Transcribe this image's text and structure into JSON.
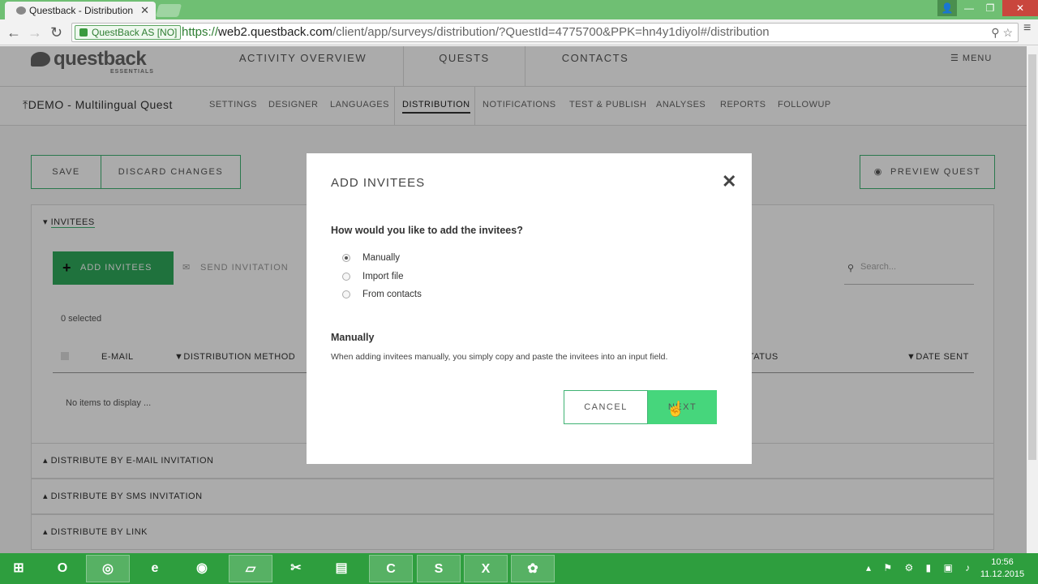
{
  "browser": {
    "tab_title": "Questback - Distribution",
    "secure_label": "QuestBack AS [NO]",
    "url_scheme": "https://",
    "url_domain": "web2.questback.com",
    "url_path": "/client/app/surveys/distribution/?QuestId=4775700&PPK=hn4y1diyol#/distribution"
  },
  "app": {
    "logo": "questback",
    "logo_sub": "ESSENTIALS",
    "top_nav": [
      "ACTIVITY OVERVIEW",
      "QUESTS",
      "CONTACTS"
    ],
    "menu_label": "MENU",
    "quest_title": "DEMO - Multilingual Quest",
    "sub_nav": [
      "SETTINGS",
      "DESIGNER",
      "LANGUAGES",
      "DISTRIBUTION",
      "NOTIFICATIONS",
      "TEST & PUBLISH",
      "ANALYSES",
      "REPORTS",
      "FOLLOWUP"
    ],
    "active_sub_nav": "DISTRIBUTION",
    "save_label": "SAVE",
    "discard_label": "DISCARD CHANGES",
    "preview_label": "PREVIEW QUEST",
    "invitees_header": "INVITEES",
    "add_invitees_label": "ADD INVITEES",
    "send_invitation_label": "SEND INVITATION",
    "search_placeholder": "Search...",
    "selected_text": "0 selected",
    "columns": [
      "E-MAIL",
      "DISTRIBUTION METHOD",
      "STATUS",
      "DATE SENT"
    ],
    "no_items": "No items to display ...",
    "accordions": [
      "DISTRIBUTE BY E-MAIL INVITATION",
      "DISTRIBUTE BY SMS INVITATION",
      "DISTRIBUTE BY LINK"
    ]
  },
  "modal": {
    "title": "ADD INVITEES",
    "question": "How would you like to add the invitees?",
    "options": [
      "Manually",
      "Import file",
      "From contacts"
    ],
    "selected_option": "Manually",
    "desc_title": "Manually",
    "desc_text": "When adding invitees manually, you simply copy and paste the invitees into an input field.",
    "cancel_label": "CANCEL",
    "next_label": "NEXT"
  },
  "taskbar": {
    "time": "10:56",
    "date": "11.12.2015"
  },
  "colors": {
    "accent_green": "#2faa5b",
    "next_green": "#46d67c",
    "taskbar": "#2e9e3e"
  }
}
